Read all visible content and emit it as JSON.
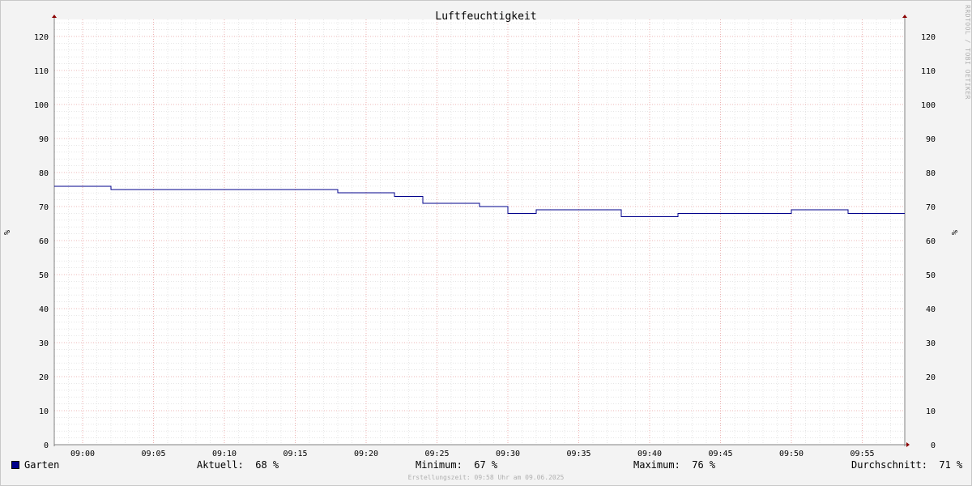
{
  "chart_data": {
    "type": "line",
    "title": "Luftfeuchtigkeit",
    "ylabel": "%",
    "ylabel_right": "%",
    "ylim": [
      0,
      125
    ],
    "yticks": [
      0,
      10,
      20,
      30,
      40,
      50,
      60,
      70,
      80,
      90,
      100,
      110,
      120
    ],
    "xlim_minutes": [
      538,
      598
    ],
    "xticks": [
      {
        "min": 540,
        "label": "09:00"
      },
      {
        "min": 545,
        "label": "09:05"
      },
      {
        "min": 550,
        "label": "09:10"
      },
      {
        "min": 555,
        "label": "09:15"
      },
      {
        "min": 560,
        "label": "09:20"
      },
      {
        "min": 565,
        "label": "09:25"
      },
      {
        "min": 570,
        "label": "09:30"
      },
      {
        "min": 575,
        "label": "09:35"
      },
      {
        "min": 580,
        "label": "09:40"
      },
      {
        "min": 585,
        "label": "09:45"
      },
      {
        "min": 590,
        "label": "09:50"
      },
      {
        "min": 595,
        "label": "09:55"
      }
    ],
    "grid": true,
    "series": [
      {
        "name": "Garten",
        "color": "#00008b",
        "step": true,
        "points": [
          {
            "t": 538,
            "v": 76
          },
          {
            "t": 542,
            "v": 75
          },
          {
            "t": 558,
            "v": 74
          },
          {
            "t": 562,
            "v": 73
          },
          {
            "t": 564,
            "v": 71
          },
          {
            "t": 568,
            "v": 70
          },
          {
            "t": 570,
            "v": 68
          },
          {
            "t": 572,
            "v": 69
          },
          {
            "t": 578,
            "v": 67
          },
          {
            "t": 582,
            "v": 68
          },
          {
            "t": 590,
            "v": 69
          },
          {
            "t": 594,
            "v": 68
          },
          {
            "t": 598,
            "v": 68
          }
        ]
      }
    ]
  },
  "legend": {
    "series_name": "Garten",
    "current": "Aktuell:  68 %",
    "minimum": "Minimum:  67 %",
    "maximum": "Maximum:  76 %",
    "average": "Durchschnitt:  71 %"
  },
  "footer": "Erstellungszeit: 09:58 Uhr am 09.06.2025",
  "watermark": "RRDTOOL / TOBI OETIKER",
  "colors": {
    "background": "#f3f3f3",
    "canvas": "#ffffff",
    "major_grid": "#e8a0a0",
    "minor_grid": "#d8d8d8",
    "axis": "#808080",
    "arrow": "#8b0000",
    "line": "#00008b"
  }
}
